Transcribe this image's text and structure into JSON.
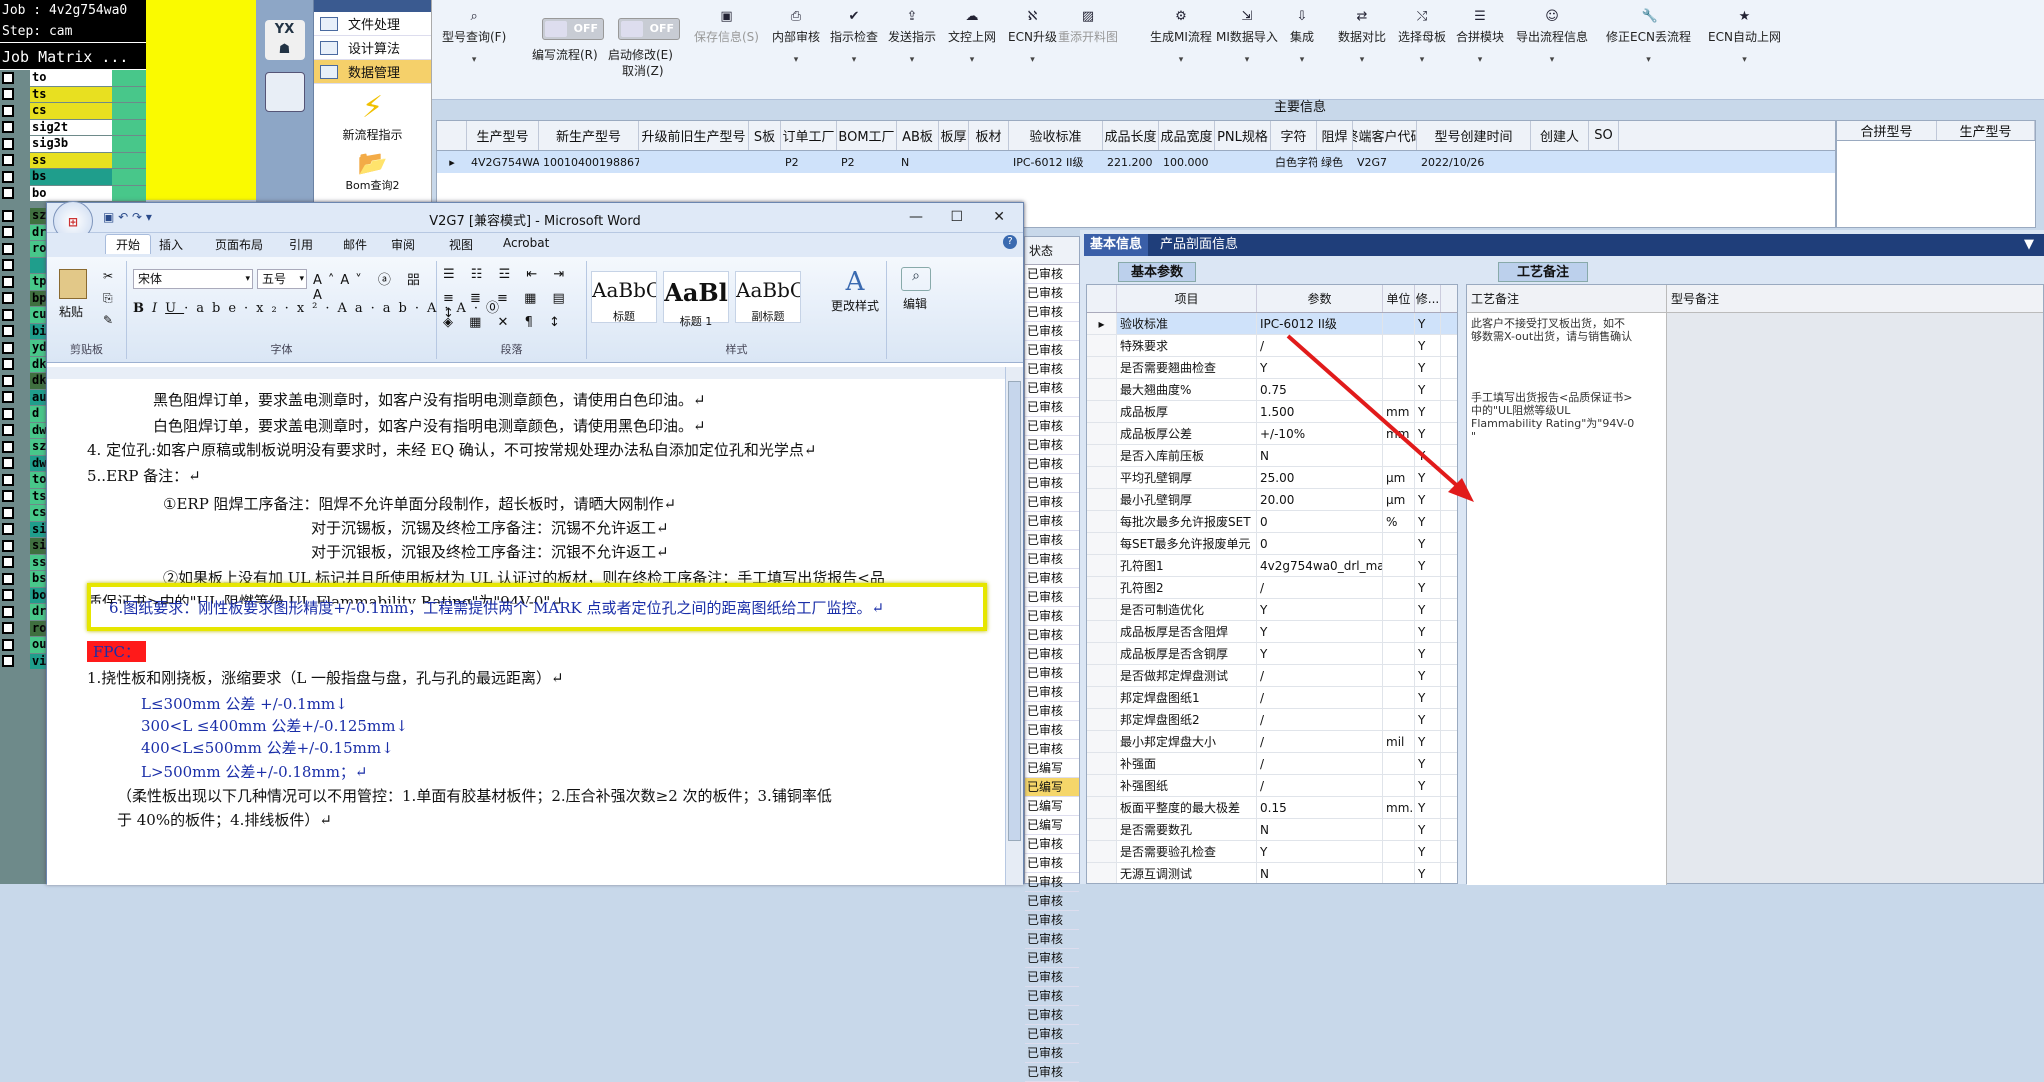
{
  "cam": {
    "job": "Job : 4v2g754wa0",
    "step": "Step: cam",
    "matrix": "Job Matrix ...",
    "layers": [
      "to",
      "ts",
      "cs",
      "sig2t",
      "sig3b",
      "ss",
      "bs",
      "bo"
    ],
    "lower_layers": [
      "sz",
      "dr",
      "ro",
      "",
      "tp",
      "bp",
      "cu",
      "bi",
      "yd",
      "dk",
      "dk",
      "au",
      "d",
      "dw",
      "sz",
      "dw",
      "to",
      "ts",
      "cs",
      "si",
      "si",
      "ss",
      "bs",
      "bo",
      "dr",
      "ro",
      "ou",
      "vi"
    ]
  },
  "nav": {
    "items": [
      "文件处理",
      "设计算法",
      "数据管理"
    ],
    "btn1": "新流程指示",
    "btn2": "Bom查询2"
  },
  "toolbar": {
    "buttons": [
      {
        "label": "型号查询(F)",
        "icon": "search-icon"
      },
      {
        "label": "编写流程(R)",
        "icon": "toggle"
      },
      {
        "label": "启动修改(E)",
        "icon": "toggle"
      },
      {
        "label": "保存信息(S)",
        "icon": "save-icon",
        "disabled": true
      },
      {
        "label": "内部审核",
        "icon": "print-icon"
      },
      {
        "label": "指示检查",
        "icon": "check-icon"
      },
      {
        "label": "发送指示",
        "icon": "upload-icon"
      },
      {
        "label": "文控上网",
        "icon": "cloud-icon"
      },
      {
        "label": "ECN升级",
        "icon": "ecn-icon"
      },
      {
        "label": "重添开料图",
        "icon": "image-icon",
        "disabled": true
      },
      {
        "label": "生成MI流程",
        "icon": "gears-icon"
      },
      {
        "label": "MI数据导入",
        "icon": "import-icon"
      },
      {
        "label": "集成",
        "icon": "download-icon"
      },
      {
        "label": "数据对比",
        "icon": "compare-icon"
      },
      {
        "label": "选择母板",
        "icon": "shuffle-icon"
      },
      {
        "label": "合拼模块",
        "icon": "list-icon"
      },
      {
        "label": "导出流程信息",
        "icon": "smile-icon"
      },
      {
        "label": "修正ECN丢流程",
        "icon": "wrench-icon"
      },
      {
        "label": "ECN自动上网",
        "icon": "star-icon"
      }
    ],
    "toggle_off": "OFF",
    "cancel_label": "取消(Z)"
  },
  "main_info": {
    "title": "主要信息",
    "headers": [
      "生产型号",
      "新生产型号",
      "升级前旧生产型号",
      "S板",
      "订单工厂",
      "BOM工厂",
      "AB板",
      "板厚",
      "板材",
      "验收标准",
      "成品长度",
      "成品宽度",
      "PNL规格",
      "字符",
      "阻焊",
      "终端客户代码",
      "型号创建时间",
      "创建人",
      "SO"
    ],
    "row": [
      "4V2G754WA0",
      "10010400198867",
      "",
      "",
      "P2",
      "P2",
      "N",
      "",
      "",
      "IPC-6012 II级",
      "221.200",
      "100.000",
      "",
      "白色字符",
      "绿色",
      "V2G7",
      "2022/10/26",
      "",
      ""
    ],
    "merge_headers": [
      "合拼型号",
      "生产型号"
    ]
  },
  "right_tabs": [
    "基本信息",
    "产品剖面信息"
  ],
  "status_col": {
    "header": "状态",
    "values": [
      "已审核",
      "已审核",
      "已审核",
      "已审核",
      "已审核",
      "已审核",
      "已审核",
      "已审核",
      "已审核",
      "已审核",
      "已审核",
      "已审核",
      "已审核",
      "已审核",
      "已审核",
      "已审核",
      "已审核",
      "已审核",
      "已审核",
      "已审核",
      "已审核",
      "已审核",
      "已审核",
      "已审核",
      "已审核",
      "已审核",
      "已编写",
      "已编写",
      "已编写",
      "已编写",
      "已审核",
      "已审核",
      "已审核",
      "已审核",
      "已审核",
      "已审核",
      "已审核",
      "已审核",
      "已审核",
      "已审核",
      "已审核",
      "已审核",
      "已审核"
    ]
  },
  "basic_params": {
    "tab": "基本参数",
    "headers": [
      "项目",
      "参数",
      "单位",
      "修..."
    ],
    "rows": [
      [
        "验收标准",
        "IPC-6012 II级",
        "",
        "Y"
      ],
      [
        "特殊要求",
        "/",
        "",
        "Y"
      ],
      [
        "是否需要翘曲检查",
        "Y",
        "",
        "Y"
      ],
      [
        "最大翘曲度%",
        "0.75",
        "",
        "Y"
      ],
      [
        "成品板厚",
        "1.500",
        "mm",
        "Y"
      ],
      [
        "成品板厚公差",
        "+/-10%",
        "mm",
        "Y"
      ],
      [
        "是否入库前压板",
        "N",
        "",
        "Y"
      ],
      [
        "平均孔壁铜厚",
        "25.00",
        "μm",
        "Y"
      ],
      [
        "最小孔壁铜厚",
        "20.00",
        "μm",
        "Y"
      ],
      [
        "每批次最多允许报废SET",
        "0",
        "%",
        "Y"
      ],
      [
        "每SET最多允许报废单元",
        "0",
        "",
        "Y"
      ],
      [
        "孔符图1",
        "4v2g754wa0_drl_ma...",
        "",
        "Y"
      ],
      [
        "孔符图2",
        "/",
        "",
        "Y"
      ],
      [
        "是否可制造优化",
        "Y",
        "",
        "Y"
      ],
      [
        "成品板厚是否含阻焊",
        "Y",
        "",
        "Y"
      ],
      [
        "成品板厚是否含铜厚",
        "Y",
        "",
        "Y"
      ],
      [
        "是否做邦定焊盘测试",
        "/",
        "",
        "Y"
      ],
      [
        "邦定焊盘图纸1",
        "/",
        "",
        "Y"
      ],
      [
        "邦定焊盘图纸2",
        "/",
        "",
        "Y"
      ],
      [
        "最小邦定焊盘大小",
        "/",
        "mil",
        "Y"
      ],
      [
        "补强面",
        "/",
        "",
        "Y"
      ],
      [
        "补强图纸",
        "/",
        "",
        "Y"
      ],
      [
        "板面平整度的最大极差",
        "0.15",
        "mm...",
        "Y"
      ],
      [
        "是否需要数孔",
        "N",
        "",
        "Y"
      ],
      [
        "是否需要验孔检查",
        "Y",
        "",
        "Y"
      ],
      [
        "无源互调测试",
        "N",
        "",
        "Y"
      ]
    ]
  },
  "process_notes": {
    "tab": "工艺备注",
    "headers": [
      "工艺备注",
      "型号备注"
    ],
    "note1": "此客户不接受打叉板出货，如不\n够数需X-out出货，请与销售确认",
    "note2": "手工填写出货报告<品质保证书>\n中的\"UL阻燃等级UL\nFlammability Rating\"为\"94V-0\n\""
  },
  "word": {
    "title": "V2G7 [兼容模式] - Microsoft Word",
    "tabs": [
      "开始",
      "插入",
      "页面布局",
      "引用",
      "邮件",
      "审阅",
      "视图",
      "Acrobat"
    ],
    "font_name": "宋体",
    "font_size": "五号",
    "groups": [
      "剪贴板",
      "字体",
      "段落",
      "样式",
      "编辑"
    ],
    "paste": "粘贴",
    "styles": [
      {
        "sample": "AaBbC",
        "name": "标题"
      },
      {
        "sample": "AaBl",
        "name": "标题 1"
      },
      {
        "sample": "AaBbC",
        "name": "副标题"
      }
    ],
    "change_styles": "更改样式",
    "edit": "编辑",
    "lines": [
      "黑色阻焊订单，要求盖电测章时，如客户没有指明电测章颜色，请使用白色印油。↵",
      "白色阻焊订单，要求盖电测章时，如客户没有指明电测章颜色，请使用黑色印油。↵",
      "4. 定位孔:如客户原稿或制板说明没有要求时，未经 EQ 确认，不可按常规处理办法私自添加定位孔和光学点↵",
      "5..ERP 备注：↵",
      "①ERP 阻焊工序备注：阻焊不允许单面分段制作，超长板时，请晒大网制作↵",
      "对于沉锡板，沉锡及终检工序备注：沉锡不允许返工↵",
      "对于沉银板，沉银及终检工序备注：沉银不允许返工↵",
      "②如果板上没有加 UL 标记并且所使用板材为 UL 认证过的板材，则在终检工序备注：手工填写出货报告<品",
      "质保证书>中的\"UL 阻燃等级 UL Flammability Rating\"为\"94V-0\"↵",
      "6.图纸要求：刚性板要求图形精度+/-0.1mm，工程需提供两个 MARK 点或者定位孔之间的距离图纸给工厂监控。↵",
      "FPC：",
      "1.挠性板和刚挠板，涨缩要求（L 一般指盘与盘，孔与孔的最远距离）↵",
      "L≤300mm 公差 +/-0.1mm↓",
      "300<L ≤400mm 公差+/-0.125mm↓",
      "400<L≤500mm 公差+/-0.15mm↓",
      "L>500mm 公差+/-0.18mm；↵",
      "（柔性板出现以下几种情况可以不用管控：1.单面有胶基材板件；2.压合补强次数≥2 次的板件；3.铺铜率低",
      "于 40%的板件；4.排线板件）↵"
    ]
  },
  "colors": {
    "accent": "#1f3e7a",
    "highlight_box": "#e6e600",
    "arrow": "#e11b1b",
    "fpc_bg": "#ff1a1a"
  }
}
